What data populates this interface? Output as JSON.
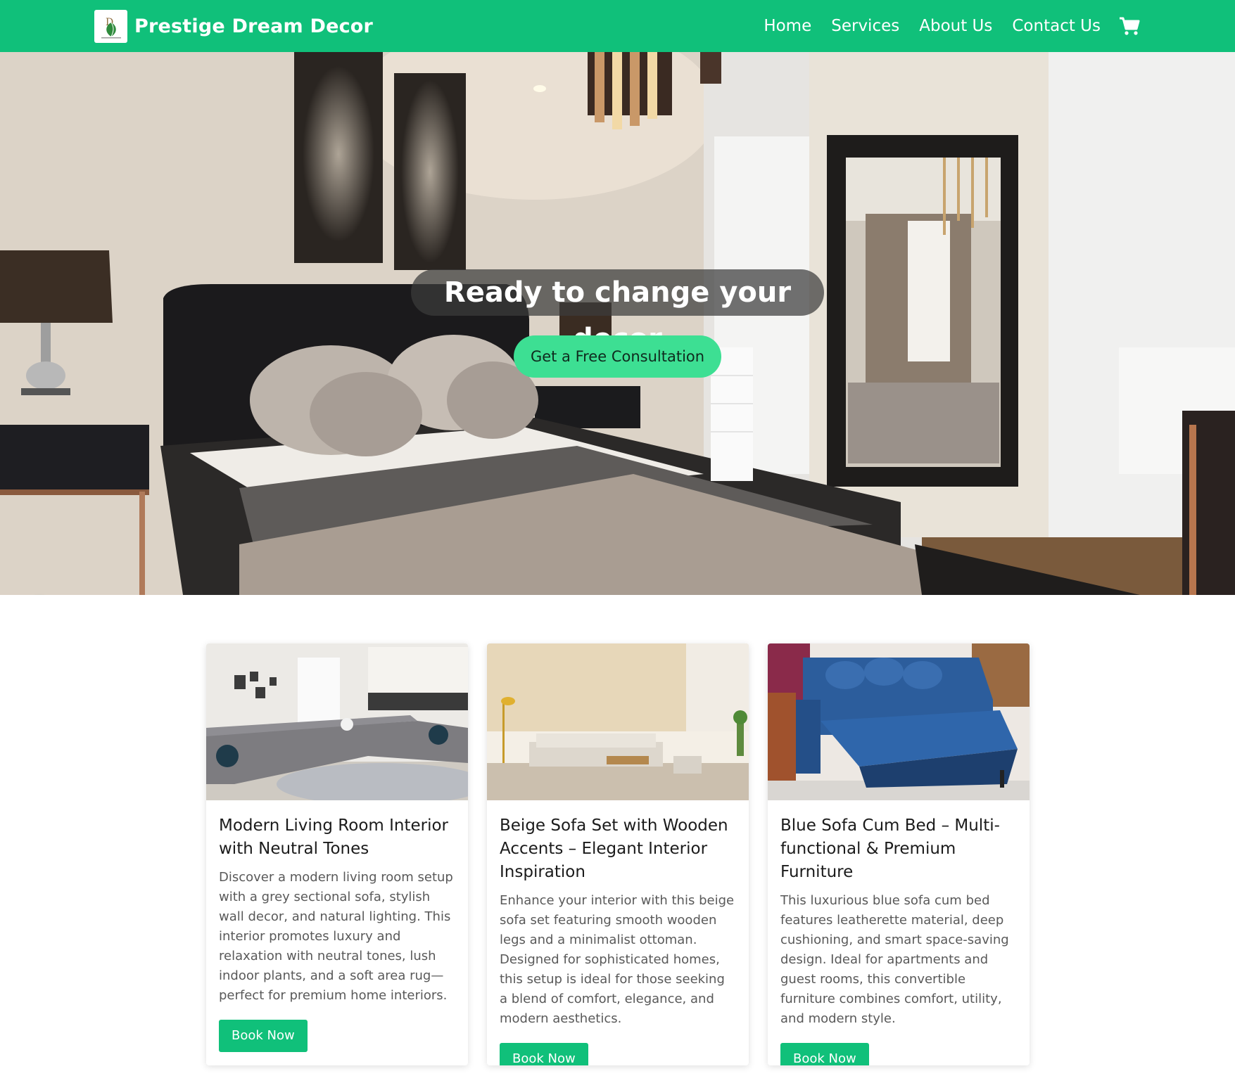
{
  "brand": {
    "name": "Prestige Dream Decor",
    "logo_icon": "leaf-logo-icon"
  },
  "nav": {
    "items": [
      {
        "label": "Home"
      },
      {
        "label": "Services"
      },
      {
        "label": "About Us"
      },
      {
        "label": "Contact Us"
      }
    ],
    "cart_icon": "cart-icon"
  },
  "hero": {
    "title": "Ready to change your decor",
    "cta_label": "Get a Free Consultation",
    "phone_icon": "phone-icon",
    "whatsapp_icon": "whatsapp-icon"
  },
  "cards": [
    {
      "title": "Modern Living Room Interior with Neutral Tones",
      "text": "Discover a modern living room setup with a grey sectional sofa, stylish wall decor, and natural lighting. This interior promotes luxury and relaxation with neutral tones, lush indoor plants, and a soft area rug—perfect for premium home interiors.",
      "button": "Book Now"
    },
    {
      "title": "Beige Sofa Set with Wooden Accents – Elegant Interior Inspiration",
      "text": "Enhance your interior with this beige sofa set featuring smooth wooden legs and a minimalist ottoman. Designed for sophisticated homes, this setup is ideal for those seeking a blend of comfort, elegance, and modern aesthetics.",
      "button": "Book Now"
    },
    {
      "title": "Blue Sofa Cum Bed – Multi-functional & Premium Furniture",
      "text": "This luxurious blue sofa cum bed features leatherette material, deep cushioning, and smart space-saving design. Ideal for apartments and guest rooms, this convertible furniture combines comfort, utility, and modern style.",
      "button": "Book Now"
    }
  ],
  "colors": {
    "primary": "#10c07a",
    "cta": "#3ddf93",
    "phone": "#2f6ee8",
    "whatsapp": "#12c55f"
  }
}
